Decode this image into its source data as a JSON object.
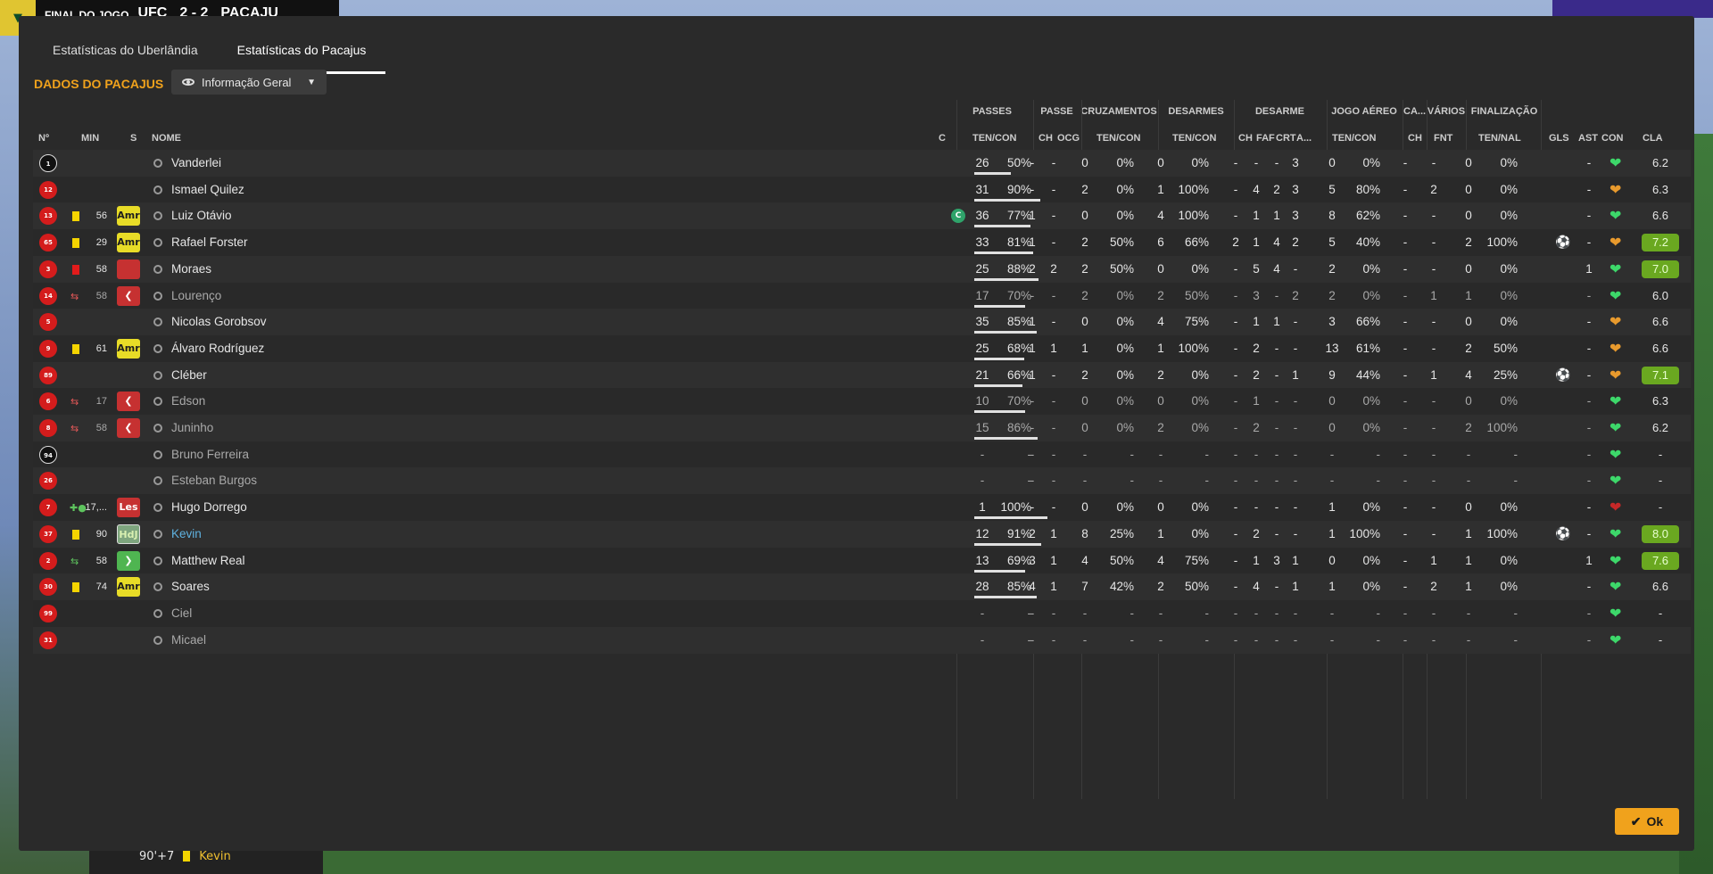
{
  "topbar": {
    "status": "FINAL DO JOGO",
    "home": "UFC",
    "score": "2 - 2",
    "away": "PACAJU"
  },
  "bottombar": {
    "minute": "90'+7",
    "player": "Kevin"
  },
  "tabs": [
    {
      "label": "Estatísticas do Uberlândia",
      "active": false
    },
    {
      "label": "Estatísticas do Pacajus",
      "active": true
    }
  ],
  "panel_title": "DADOS DO PACAJUS",
  "view_select": {
    "value": "Informação Geral"
  },
  "group_headers": {
    "passes": "PASSES",
    "passe": "PASSE",
    "cruzamentos": "CRUZAMENTOS",
    "desarmes": "DESARMES",
    "desarme": "DESARME",
    "jogo_aereo": "JOGO AÉREO",
    "ca": "CA...",
    "varios": "VÁRIOS",
    "finalizacao": "FINALIZAÇÃO"
  },
  "col_headers": {
    "num": "Nº",
    "min": "MIN",
    "s": "S",
    "nome": "NOME",
    "c": "C",
    "ten_con": "TEN/CON",
    "ch": "CH",
    "ocg": "OCG",
    "cruz": "TEN/CON",
    "desar": "TEN/CON",
    "d_ch": "CH",
    "faf": "FAF",
    "crt": "CRT",
    "a": "A...",
    "aereo": "TEN/CON",
    "ca_ch": "CH",
    "fnt": "FNT",
    "ten_nal": "TEN/NAL",
    "gls": "GLS",
    "ast": "AST",
    "con": "CON",
    "cla": "CLA"
  },
  "players": [
    {
      "num": "1",
      "name": "Vanderlei",
      "min": "",
      "mark": "",
      "pt": "26",
      "pp": "50%",
      "ch": "-",
      "ocg": "-",
      "ct": "0",
      "cp": "0%",
      "dt": "0",
      "dp": "0%",
      "dch": "-",
      "faf": "-",
      "crt": "-",
      "a": "3",
      "at": "0",
      "ap": "0%",
      "cach": "-",
      "fnt": "-",
      "ft": "0",
      "fp": "0%",
      "gls": "",
      "ast": "-",
      "cla": "6.2"
    },
    {
      "num": "12",
      "name": "Ismael Quilez",
      "min": "",
      "mark": "",
      "pt": "31",
      "pp": "90%",
      "ch": "-",
      "ocg": "-",
      "ct": "2",
      "cp": "0%",
      "dt": "1",
      "dp": "100%",
      "dch": "-",
      "faf": "4",
      "crt": "2",
      "a": "3",
      "at": "5",
      "ap": "80%",
      "cach": "-",
      "fnt": "2",
      "ft": "0",
      "fp": "0%",
      "gls": "",
      "ast": "-",
      "cla": "6.3"
    },
    {
      "num": "13",
      "name": "Luiz Otávio",
      "min": "56",
      "mark": "Amr",
      "pt": "36",
      "pp": "77%",
      "ch": "1",
      "ocg": "-",
      "ct": "0",
      "cp": "0%",
      "dt": "4",
      "dp": "100%",
      "dch": "-",
      "faf": "1",
      "crt": "1",
      "a": "3",
      "at": "8",
      "ap": "62%",
      "cach": "-",
      "fnt": "-",
      "ft": "0",
      "fp": "0%",
      "gls": "",
      "ast": "-",
      "cla": "6.6",
      "captain": "C"
    },
    {
      "num": "65",
      "name": "Rafael Forster",
      "min": "29",
      "mark": "Amr",
      "pt": "33",
      "pp": "81%",
      "ch": "1",
      "ocg": "-",
      "ct": "2",
      "cp": "50%",
      "dt": "6",
      "dp": "66%",
      "dch": "2",
      "faf": "1",
      "crt": "4",
      "a": "2",
      "at": "5",
      "ap": "40%",
      "cach": "-",
      "fnt": "-",
      "ft": "2",
      "fp": "100%",
      "gls": "ball",
      "ast": "-",
      "cla": "7.2"
    },
    {
      "num": "3",
      "name": "Moraes",
      "min": "58",
      "mark": "red",
      "pt": "25",
      "pp": "88%",
      "ch": "2",
      "ocg": "2",
      "ct": "2",
      "cp": "50%",
      "dt": "0",
      "dp": "0%",
      "dch": "-",
      "faf": "5",
      "crt": "4",
      "a": "-",
      "at": "2",
      "ap": "0%",
      "cach": "-",
      "fnt": "-",
      "ft": "0",
      "fp": "0%",
      "gls": "",
      "ast": "1",
      "cla": "7.0"
    },
    {
      "num": "14",
      "name": "Lourenço",
      "min": "58",
      "mark": "out",
      "pt": "17",
      "pp": "70%",
      "ch": "-",
      "ocg": "-",
      "ct": "2",
      "cp": "0%",
      "dt": "2",
      "dp": "50%",
      "dch": "-",
      "faf": "3",
      "crt": "-",
      "a": "2",
      "at": "2",
      "ap": "0%",
      "cach": "-",
      "fnt": "1",
      "ft": "1",
      "fp": "0%",
      "gls": "",
      "ast": "-",
      "cla": "6.0"
    },
    {
      "num": "5",
      "name": "Nicolas Gorobsov",
      "min": "",
      "mark": "",
      "pt": "35",
      "pp": "85%",
      "ch": "1",
      "ocg": "-",
      "ct": "0",
      "cp": "0%",
      "dt": "4",
      "dp": "75%",
      "dch": "-",
      "faf": "1",
      "crt": "1",
      "a": "-",
      "at": "3",
      "ap": "66%",
      "cach": "-",
      "fnt": "-",
      "ft": "0",
      "fp": "0%",
      "gls": "",
      "ast": "-",
      "cla": "6.6"
    },
    {
      "num": "9",
      "name": "Álvaro Rodríguez",
      "min": "61",
      "mark": "Amr",
      "pt": "25",
      "pp": "68%",
      "ch": "1",
      "ocg": "1",
      "ct": "1",
      "cp": "0%",
      "dt": "1",
      "dp": "100%",
      "dch": "-",
      "faf": "2",
      "crt": "-",
      "a": "-",
      "at": "13",
      "ap": "61%",
      "cach": "-",
      "fnt": "-",
      "ft": "2",
      "fp": "50%",
      "gls": "",
      "ast": "-",
      "cla": "6.6"
    },
    {
      "num": "89",
      "name": "Cléber",
      "min": "",
      "mark": "",
      "pt": "21",
      "pp": "66%",
      "ch": "1",
      "ocg": "-",
      "ct": "2",
      "cp": "0%",
      "dt": "2",
      "dp": "0%",
      "dch": "-",
      "faf": "2",
      "crt": "-",
      "a": "1",
      "at": "9",
      "ap": "44%",
      "cach": "-",
      "fnt": "1",
      "ft": "4",
      "fp": "25%",
      "gls": "ball",
      "ast": "-",
      "cla": "7.1"
    },
    {
      "num": "6",
      "name": "Edson",
      "min": "17",
      "mark": "out",
      "pt": "10",
      "pp": "70%",
      "ch": "-",
      "ocg": "-",
      "ct": "0",
      "cp": "0%",
      "dt": "0",
      "dp": "0%",
      "dch": "-",
      "faf": "1",
      "crt": "-",
      "a": "-",
      "at": "0",
      "ap": "0%",
      "cach": "-",
      "fnt": "-",
      "ft": "0",
      "fp": "0%",
      "gls": "",
      "ast": "-",
      "cla": "6.3"
    },
    {
      "num": "8",
      "name": "Juninho",
      "min": "58",
      "mark": "out",
      "pt": "15",
      "pp": "86%",
      "ch": "-",
      "ocg": "-",
      "ct": "0",
      "cp": "0%",
      "dt": "2",
      "dp": "0%",
      "dch": "-",
      "faf": "2",
      "crt": "-",
      "a": "-",
      "at": "0",
      "ap": "0%",
      "cach": "-",
      "fnt": "-",
      "ft": "2",
      "fp": "100%",
      "gls": "",
      "ast": "-",
      "cla": "6.2"
    },
    {
      "num": "94",
      "name": "Bruno Ferreira",
      "min": "",
      "mark": "",
      "pt": "-",
      "pp": "-",
      "ch": "-",
      "ocg": "-",
      "ct": "-",
      "cp": "-",
      "dt": "-",
      "dp": "-",
      "dch": "-",
      "faf": "-",
      "crt": "-",
      "a": "-",
      "at": "-",
      "ap": "-",
      "cach": "-",
      "fnt": "-",
      "ft": "-",
      "fp": "-",
      "gls": "",
      "ast": "-",
      "cla": "-"
    },
    {
      "num": "26",
      "name": "Esteban Burgos",
      "min": "",
      "mark": "",
      "pt": "-",
      "pp": "-",
      "ch": "-",
      "ocg": "-",
      "ct": "-",
      "cp": "-",
      "dt": "-",
      "dp": "-",
      "dch": "-",
      "faf": "-",
      "crt": "-",
      "a": "-",
      "at": "-",
      "ap": "-",
      "cach": "-",
      "fnt": "-",
      "ft": "-",
      "fp": "-",
      "gls": "",
      "ast": "-",
      "cla": "-"
    },
    {
      "num": "7",
      "name": "Hugo Dorrego",
      "min": "17,...",
      "mark": "Les",
      "pt": "1",
      "pp": "100%",
      "ch": "-",
      "ocg": "-",
      "ct": "0",
      "cp": "0%",
      "dt": "0",
      "dp": "0%",
      "dch": "-",
      "faf": "-",
      "crt": "-",
      "a": "-",
      "at": "1",
      "ap": "0%",
      "cach": "-",
      "fnt": "-",
      "ft": "0",
      "fp": "0%",
      "gls": "",
      "ast": "-",
      "cla": "-"
    },
    {
      "num": "37",
      "name": "Kevin",
      "min": "90",
      "mark": "HdJ",
      "pt": "12",
      "pp": "91%",
      "ch": "2",
      "ocg": "1",
      "ct": "8",
      "cp": "25%",
      "dt": "1",
      "dp": "0%",
      "dch": "-",
      "faf": "2",
      "crt": "-",
      "a": "-",
      "at": "1",
      "ap": "100%",
      "cach": "-",
      "fnt": "-",
      "ft": "1",
      "fp": "100%",
      "gls": "ball",
      "ast": "-",
      "cla": "8.0"
    },
    {
      "num": "2",
      "name": "Matthew Real",
      "min": "58",
      "mark": "in",
      "pt": "13",
      "pp": "69%",
      "ch": "3",
      "ocg": "1",
      "ct": "4",
      "cp": "50%",
      "dt": "4",
      "dp": "75%",
      "dch": "-",
      "faf": "1",
      "crt": "3",
      "a": "1",
      "at": "0",
      "ap": "0%",
      "cach": "-",
      "fnt": "1",
      "ft": "1",
      "fp": "0%",
      "gls": "",
      "ast": "1",
      "cla": "7.6"
    },
    {
      "num": "30",
      "name": "Soares",
      "min": "74",
      "mark": "Amr",
      "pt": "28",
      "pp": "85%",
      "ch": "4",
      "ocg": "1",
      "ct": "7",
      "cp": "42%",
      "dt": "2",
      "dp": "50%",
      "dch": "-",
      "faf": "4",
      "crt": "-",
      "a": "1",
      "at": "1",
      "ap": "0%",
      "cach": "-",
      "fnt": "2",
      "ft": "1",
      "fp": "0%",
      "gls": "",
      "ast": "-",
      "cla": "6.6"
    },
    {
      "num": "99",
      "name": "Ciel",
      "min": "",
      "mark": "",
      "pt": "-",
      "pp": "-",
      "ch": "-",
      "ocg": "-",
      "ct": "-",
      "cp": "-",
      "dt": "-",
      "dp": "-",
      "dch": "-",
      "faf": "-",
      "crt": "-",
      "a": "-",
      "at": "-",
      "ap": "-",
      "cach": "-",
      "fnt": "-",
      "ft": "-",
      "fp": "-",
      "gls": "",
      "ast": "-",
      "cla": "-"
    },
    {
      "num": "31",
      "name": "Micael",
      "min": "",
      "mark": "",
      "pt": "-",
      "pp": "-",
      "ch": "-",
      "ocg": "-",
      "ct": "-",
      "cp": "-",
      "dt": "-",
      "dp": "-",
      "dch": "-",
      "faf": "-",
      "crt": "-",
      "a": "-",
      "at": "-",
      "ap": "-",
      "cach": "-",
      "fnt": "-",
      "ft": "-",
      "fp": "-",
      "gls": "",
      "ast": "-",
      "cla": "-"
    }
  ],
  "ok_label": "Ok"
}
